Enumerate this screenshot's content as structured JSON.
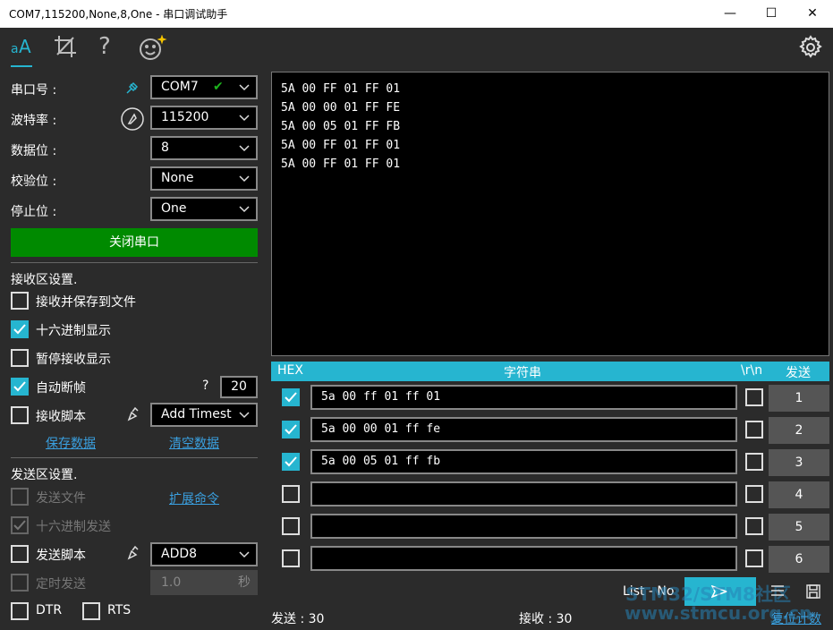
{
  "window": {
    "title": "COM7,115200,None,8,One - 串口调试助手"
  },
  "toolbar": {
    "help_glyph": "?"
  },
  "port": {
    "port_label": "串口号 :",
    "port_value": "COM7",
    "baud_label": "波特率 :",
    "baud_value": "115200",
    "data_label": "数据位 :",
    "data_value": "8",
    "parity_label": "校验位 :",
    "parity_value": "None",
    "stop_label": "停止位 :",
    "stop_value": "One",
    "close_button": "关闭串口"
  },
  "receive": {
    "section": "接收区设置.",
    "save_to_file": "接收并保存到文件",
    "hex_display": "十六进制显示",
    "pause_display": "暂停接收显示",
    "auto_frame": "自动断帧",
    "frame_help": "?",
    "frame_value": "20",
    "script": "接收脚本",
    "script_value": "Add Timest",
    "save_data": "保存数据",
    "clear_data": "清空数据",
    "lines": [
      "5A 00 FF 01 FF 01",
      "5A 00 00 01 FF FE",
      "5A 00 05 01 FF FB",
      "5A 00 FF 01 FF 01",
      "5A 00 FF 01 FF 01"
    ]
  },
  "send": {
    "section": "发送区设置.",
    "send_file": "发送文件",
    "extend_cmd": "扩展命令",
    "hex_send": "十六进制发送",
    "script": "发送脚本",
    "script_value": "ADD8",
    "timed_send": "定时发送",
    "timer_value": "1.0",
    "timer_unit": "秒",
    "dtr": "DTR",
    "rts": "RTS",
    "head_hex": "HEX",
    "head_string": "字符串",
    "head_crlf": "\\r\\n",
    "head_send": "发送",
    "rows": [
      {
        "hex": true,
        "text": "5a 00 ff 01 ff 01",
        "num": "1"
      },
      {
        "hex": true,
        "text": "5a 00 00 01 ff fe",
        "num": "2"
      },
      {
        "hex": true,
        "text": "5a 00 05 01 ff fb",
        "num": "3"
      },
      {
        "hex": false,
        "text": "",
        "num": "4"
      },
      {
        "hex": false,
        "text": "",
        "num": "5"
      },
      {
        "hex": false,
        "text": "",
        "num": "6"
      }
    ],
    "list_label": "List - No",
    "watermark": "STM32/STM8社区",
    "watermark_url": "www.stmcu.org.cn"
  },
  "status": {
    "sent": "发送 : 30",
    "received": "接收 : 30",
    "reset": "复位计数"
  }
}
